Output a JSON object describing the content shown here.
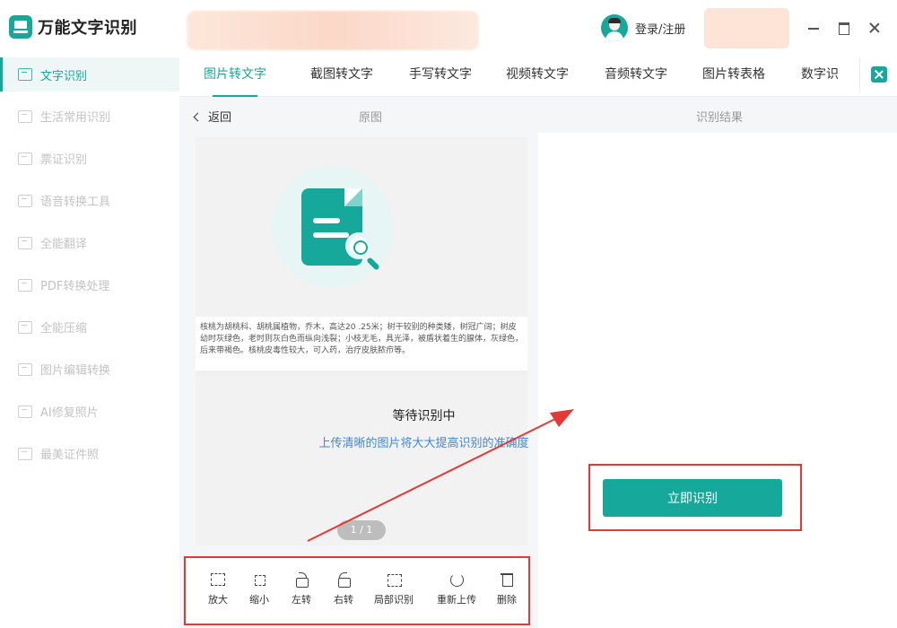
{
  "app": {
    "title": "万能文字识别"
  },
  "header": {
    "login_label": "登录/注册"
  },
  "sidebar": {
    "items": [
      {
        "label": "文字识别",
        "active": true
      },
      {
        "label": "生活常用识别"
      },
      {
        "label": "票证识别"
      },
      {
        "label": "语音转换工具"
      },
      {
        "label": "全能翻译"
      },
      {
        "label": "PDF转换处理"
      },
      {
        "label": "全能压缩"
      },
      {
        "label": "图片编辑转换"
      },
      {
        "label": "AI修复照片"
      },
      {
        "label": "最美证件照"
      }
    ]
  },
  "tabs": [
    {
      "label": "图片转文字",
      "active": true
    },
    {
      "label": "截图转文字"
    },
    {
      "label": "手写转文字"
    },
    {
      "label": "视频转文字"
    },
    {
      "label": "音频转文字"
    },
    {
      "label": "图片转表格"
    },
    {
      "label": "数字识"
    }
  ],
  "subbar": {
    "back": "返回",
    "original": "原图",
    "result": "识别结果"
  },
  "preview": {
    "text": "核桃为胡桃科、胡桃属植物，乔木，高达20 .25米；树干较别的种类矮，树冠广阔；树皮幼时灰绿色，老时则灰白色而纵向浅裂；小枝无毛，具光泽，被盾状着生的腺体，灰绿色，后来带褐色。核桃皮毒性较大，可入药，治疗皮肤脓疖等。",
    "page_indicator": "1 / 1"
  },
  "toolbar": {
    "zoom_in": "放大",
    "zoom_out": "缩小",
    "rotate_left": "左转",
    "rotate_right": "右转",
    "partial": "局部识别",
    "reupload": "重新上传",
    "delete": "删除"
  },
  "result": {
    "status": "等待识别中",
    "hint": "上传清晰的图片将大大提高识别的准确度",
    "action": "立即识别"
  },
  "colors": {
    "accent": "#16a89a",
    "highlight": "#e53935",
    "hint": "#3f88d6"
  }
}
